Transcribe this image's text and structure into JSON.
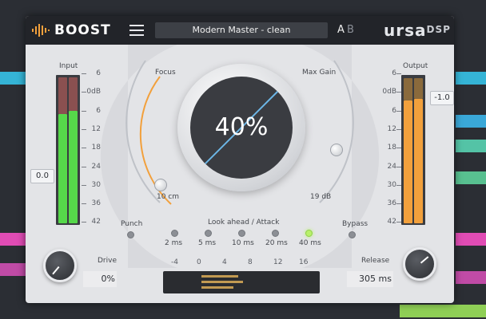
{
  "header": {
    "logo_text": "BOOST",
    "preset_name": "Modern Master - clean",
    "ab_a": "A",
    "ab_b": "B",
    "brand_main": "ursa",
    "brand_suffix": "DSP"
  },
  "input": {
    "label": "Input",
    "scale": [
      "6",
      "0dB",
      "6",
      "12",
      "18",
      "24",
      "30",
      "36",
      "42"
    ],
    "value": "0.0",
    "meter_fill": 0.73
  },
  "output": {
    "label": "Output",
    "scale": [
      "6",
      "0dB",
      "6",
      "12",
      "18",
      "24",
      "30",
      "36",
      "42"
    ],
    "value": "-1.0",
    "meter_fill": 0.82
  },
  "main_dial": {
    "value": "40%"
  },
  "focus": {
    "label": "Focus",
    "value": "10 cm"
  },
  "max_gain": {
    "label": "Max Gain",
    "value": "19 dB"
  },
  "punch": {
    "label": "Punch"
  },
  "bypass": {
    "label": "Bypass"
  },
  "lookahead": {
    "label": "Look ahead / Attack",
    "options": [
      "2 ms",
      "5 ms",
      "10 ms",
      "20 ms",
      "40 ms"
    ],
    "selected_index": 4
  },
  "drive": {
    "label": "Drive",
    "value": "0%"
  },
  "release": {
    "label": "Release",
    "value": "305 ms"
  },
  "gr_scale": [
    "-4",
    "0",
    "4",
    "8",
    "12",
    "16"
  ],
  "colors": {
    "accent_orange": "#f2a03c",
    "accent_green": "#56d84a",
    "accent_blue": "#6cb6e6",
    "led_active": "#b9f06a"
  },
  "icons": [
    "logo-wave-icon",
    "menu-icon"
  ]
}
